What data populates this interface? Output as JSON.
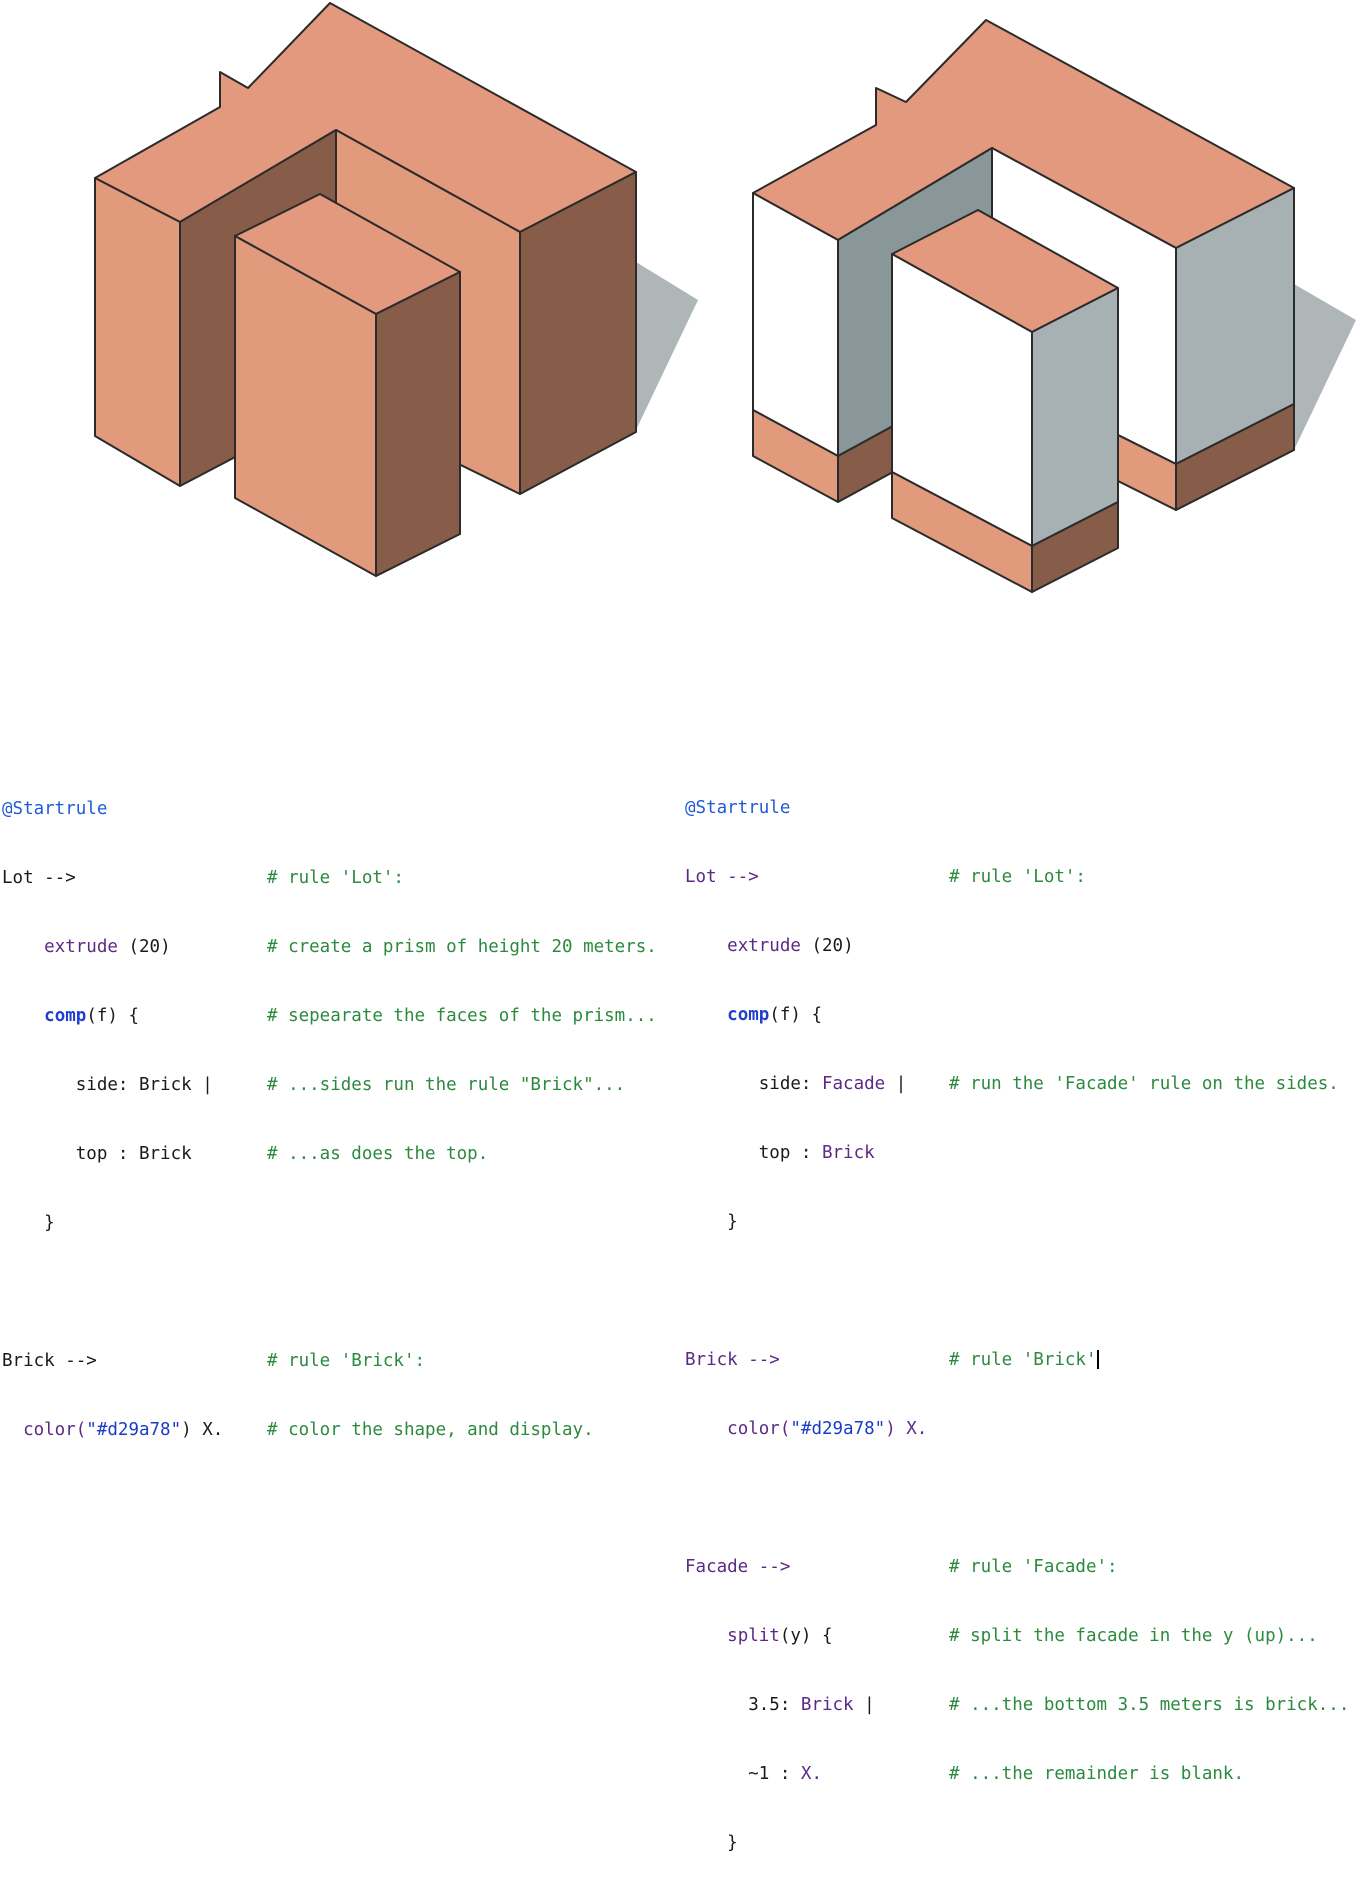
{
  "colors": {
    "brick_light": "#e29a7c",
    "brick_top": "#e3997e",
    "brick_dark": "#875c48",
    "brick_mid": "#d29a78",
    "shadow": "#aeb6b7",
    "white_face": "#ffffff",
    "grey_face": "#a7b1b3",
    "grey_dark": "#8a9799",
    "edge": "#2b2b2b",
    "comment": "#2b8a3e",
    "keyword": "#1f3fcf",
    "rule": "#5b2a86"
  },
  "left_code": {
    "l1": {
      "a": "@Startrule"
    },
    "l2": {
      "a": "Lot -->",
      "c": "# rule 'Lot':"
    },
    "l3": {
      "a": "extrude",
      "b": " (20)",
      "c": "# create a prism of height 20 meters."
    },
    "l4": {
      "a": "comp",
      "b": "(f) {",
      "c": "# sepearate the faces of the prism..."
    },
    "l5": {
      "a": "side: Brick |",
      "c": "# ...sides run the rule \"Brick\"..."
    },
    "l6": {
      "a": "top : Brick",
      "c": "# ...as does the top."
    },
    "l7": {
      "a": "}"
    },
    "l8": {
      "a": "Brick -->",
      "c": "# rule 'Brick':"
    },
    "l9": {
      "a": "color(",
      "b": "\"#d29a78\"",
      "d": ") X.",
      "c": "# color the shape, and display."
    }
  },
  "right_code": {
    "l1": {
      "a": "@Startrule"
    },
    "l2": {
      "a": "Lot -->",
      "c": "# rule 'Lot':"
    },
    "l3": {
      "a": "extrude",
      "b": " (20)"
    },
    "l4": {
      "a": "comp",
      "b": "(f) {"
    },
    "l5": {
      "a": "side: ",
      "b": "Facade",
      "d": " |",
      "c": "# run the 'Facade' rule on the sides."
    },
    "l6": {
      "a": "top : ",
      "b": "Brick"
    },
    "l7": {
      "a": "}"
    },
    "l8": {
      "a": "Brick -->",
      "c": "# rule 'Brick'"
    },
    "l9": {
      "a": "color(",
      "b": "\"#d29a78\"",
      "d": ") X."
    },
    "l10": {
      "a": "Facade -->",
      "c": "# rule 'Facade':"
    },
    "l11": {
      "a": "split",
      "b": "(y) {",
      "c": "# split the facade in the y (up)..."
    },
    "l12": {
      "a": "3.5: ",
      "b": "Brick",
      "d": " |",
      "c": "# ...the bottom 3.5 meters is brick..."
    },
    "l13": {
      "a": "~1 : ",
      "b": "X.",
      "c": "# ...the remainder is blank."
    },
    "l14": {
      "a": "}"
    }
  }
}
